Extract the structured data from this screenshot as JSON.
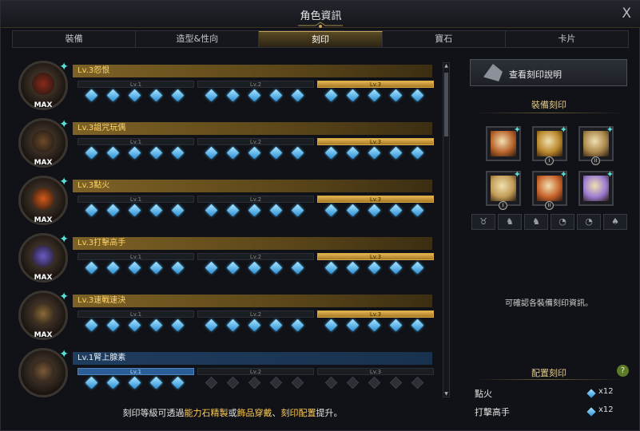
{
  "window": {
    "title": "角色資訊",
    "close_label": "X"
  },
  "tabs": [
    {
      "label": "裝備"
    },
    {
      "label": "造型&性向"
    },
    {
      "label": "刻印"
    },
    {
      "label": "寶石"
    },
    {
      "label": "卡片"
    }
  ],
  "active_tab": 2,
  "engravings": [
    {
      "name": "Lv.3怨恨",
      "max": "MAX",
      "levels": [
        "Lv.1",
        "Lv.2",
        "Lv.3"
      ],
      "current_level": 3,
      "color": "#8a2a1a"
    },
    {
      "name": "Lv.3詛咒玩偶",
      "max": "MAX",
      "levels": [
        "Lv.1",
        "Lv.2",
        "Lv.3"
      ],
      "current_level": 3,
      "color": "#6b4a2a"
    },
    {
      "name": "Lv.3點火",
      "max": "MAX",
      "levels": [
        "Lv.1",
        "Lv.2",
        "Lv.3"
      ],
      "current_level": 3,
      "color": "#d45a1a"
    },
    {
      "name": "Lv.3打擊高手",
      "max": "MAX",
      "levels": [
        "Lv.1",
        "Lv.2",
        "Lv.3"
      ],
      "current_level": 3,
      "color": "#6a5ac8"
    },
    {
      "name": "Lv.3速戰速決",
      "max": "MAX",
      "levels": [
        "Lv.1",
        "Lv.2",
        "Lv.3"
      ],
      "current_level": 3,
      "color": "#8a6a3a"
    },
    {
      "name": "Lv.1腎上腺素",
      "max": "",
      "levels": [
        "Lv.1",
        "Lv.2",
        "Lv.3"
      ],
      "current_level": 1,
      "color": "#7a5a3a"
    }
  ],
  "right": {
    "view_button": "查看刻印說明",
    "equip_title": "裝備刻印",
    "slots": [
      {
        "icon": "necklace-icon",
        "badge": "",
        "color": "#b8622a"
      },
      {
        "icon": "earring-icon",
        "badge": "I",
        "color": "#b8862a"
      },
      {
        "icon": "earring-icon",
        "badge": "II",
        "color": "#a8864a"
      },
      {
        "icon": "ring-icon",
        "badge": "I",
        "color": "#c09a55"
      },
      {
        "icon": "ring-icon",
        "badge": "II",
        "color": "#c8622a"
      },
      {
        "icon": "stone-icon",
        "badge": "",
        "color": "#9a7ad0"
      }
    ],
    "accessory_icons": [
      "necklace-filter-icon",
      "earring-1-filter-icon",
      "earring-2-filter-icon",
      "ring-1-filter-icon",
      "ring-2-filter-icon",
      "stone-filter-icon"
    ],
    "info_text": "可確認各裝備刻印資訊。",
    "config_title": "配置刻印",
    "help_label": "?",
    "configured": [
      {
        "name": "點火",
        "count": "x12"
      },
      {
        "name": "打擊高手",
        "count": "x12"
      }
    ]
  },
  "footer": {
    "p1": "刻印等級可透過",
    "h1": "能力石精製",
    "p2": "或",
    "h2": "飾品穿戴",
    "p3": "、",
    "h3": "刻印配置",
    "p4": "提升。"
  },
  "scroll": {
    "up": "▲",
    "down": "▼"
  }
}
